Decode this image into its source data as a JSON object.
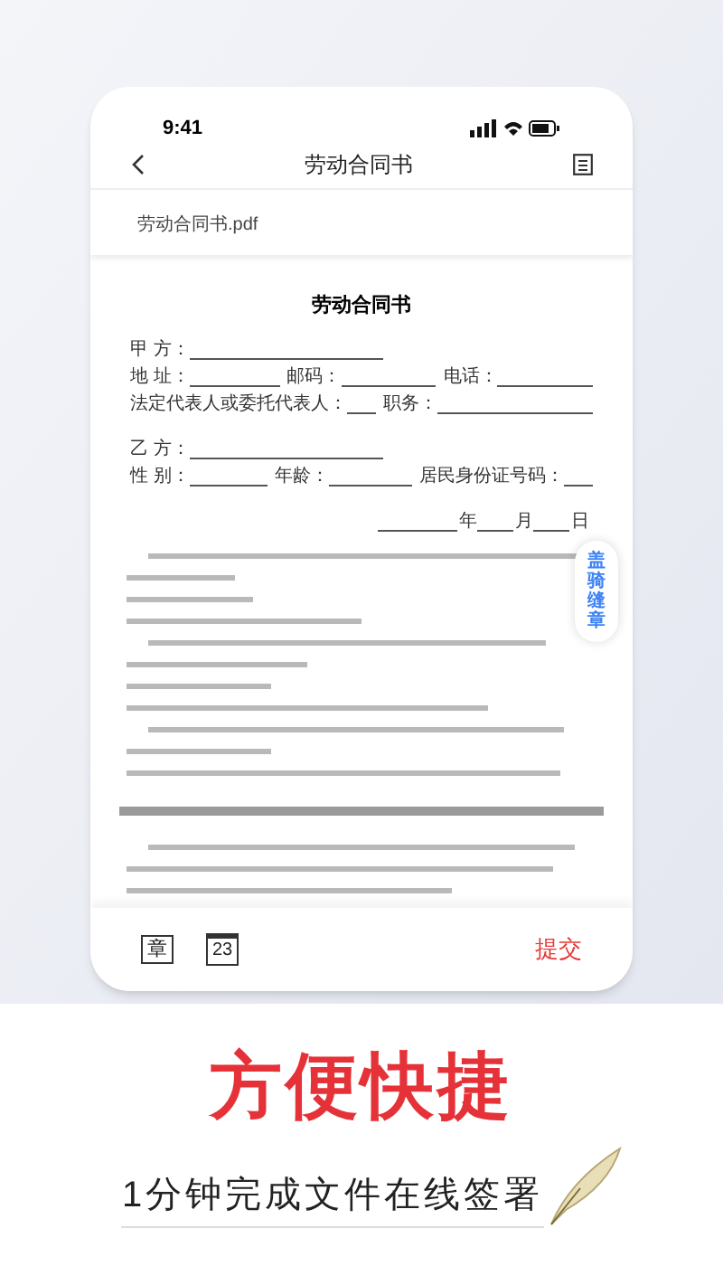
{
  "status_bar": {
    "time": "9:41"
  },
  "header": {
    "title": "劳动合同书"
  },
  "file": {
    "name": "劳动合同书.pdf"
  },
  "document": {
    "title": "劳动合同书",
    "sections": [
      {
        "rows": [
          [
            {
              "label": "甲 方："
            }
          ],
          [
            {
              "label": "地 址："
            },
            {
              "label": "邮码："
            },
            {
              "label": "电话："
            }
          ],
          [
            {
              "label": "法定代表人或委托代表人："
            },
            {
              "label": "职务："
            }
          ]
        ]
      },
      {
        "rows": [
          [
            {
              "label": "乙 方："
            }
          ],
          [
            {
              "label": "性 别："
            },
            {
              "label": "年龄："
            },
            {
              "label": "居民身份证号码："
            }
          ]
        ]
      }
    ],
    "date_labels": [
      "年",
      "月",
      "日"
    ]
  },
  "seal_button": {
    "label": "盖骑缝章"
  },
  "toolbar": {
    "stamp_label": "章",
    "date_label": "23",
    "submit": "提交"
  },
  "promo": {
    "headline": "方便快捷",
    "subtitle": "1分钟完成文件在线签署"
  }
}
